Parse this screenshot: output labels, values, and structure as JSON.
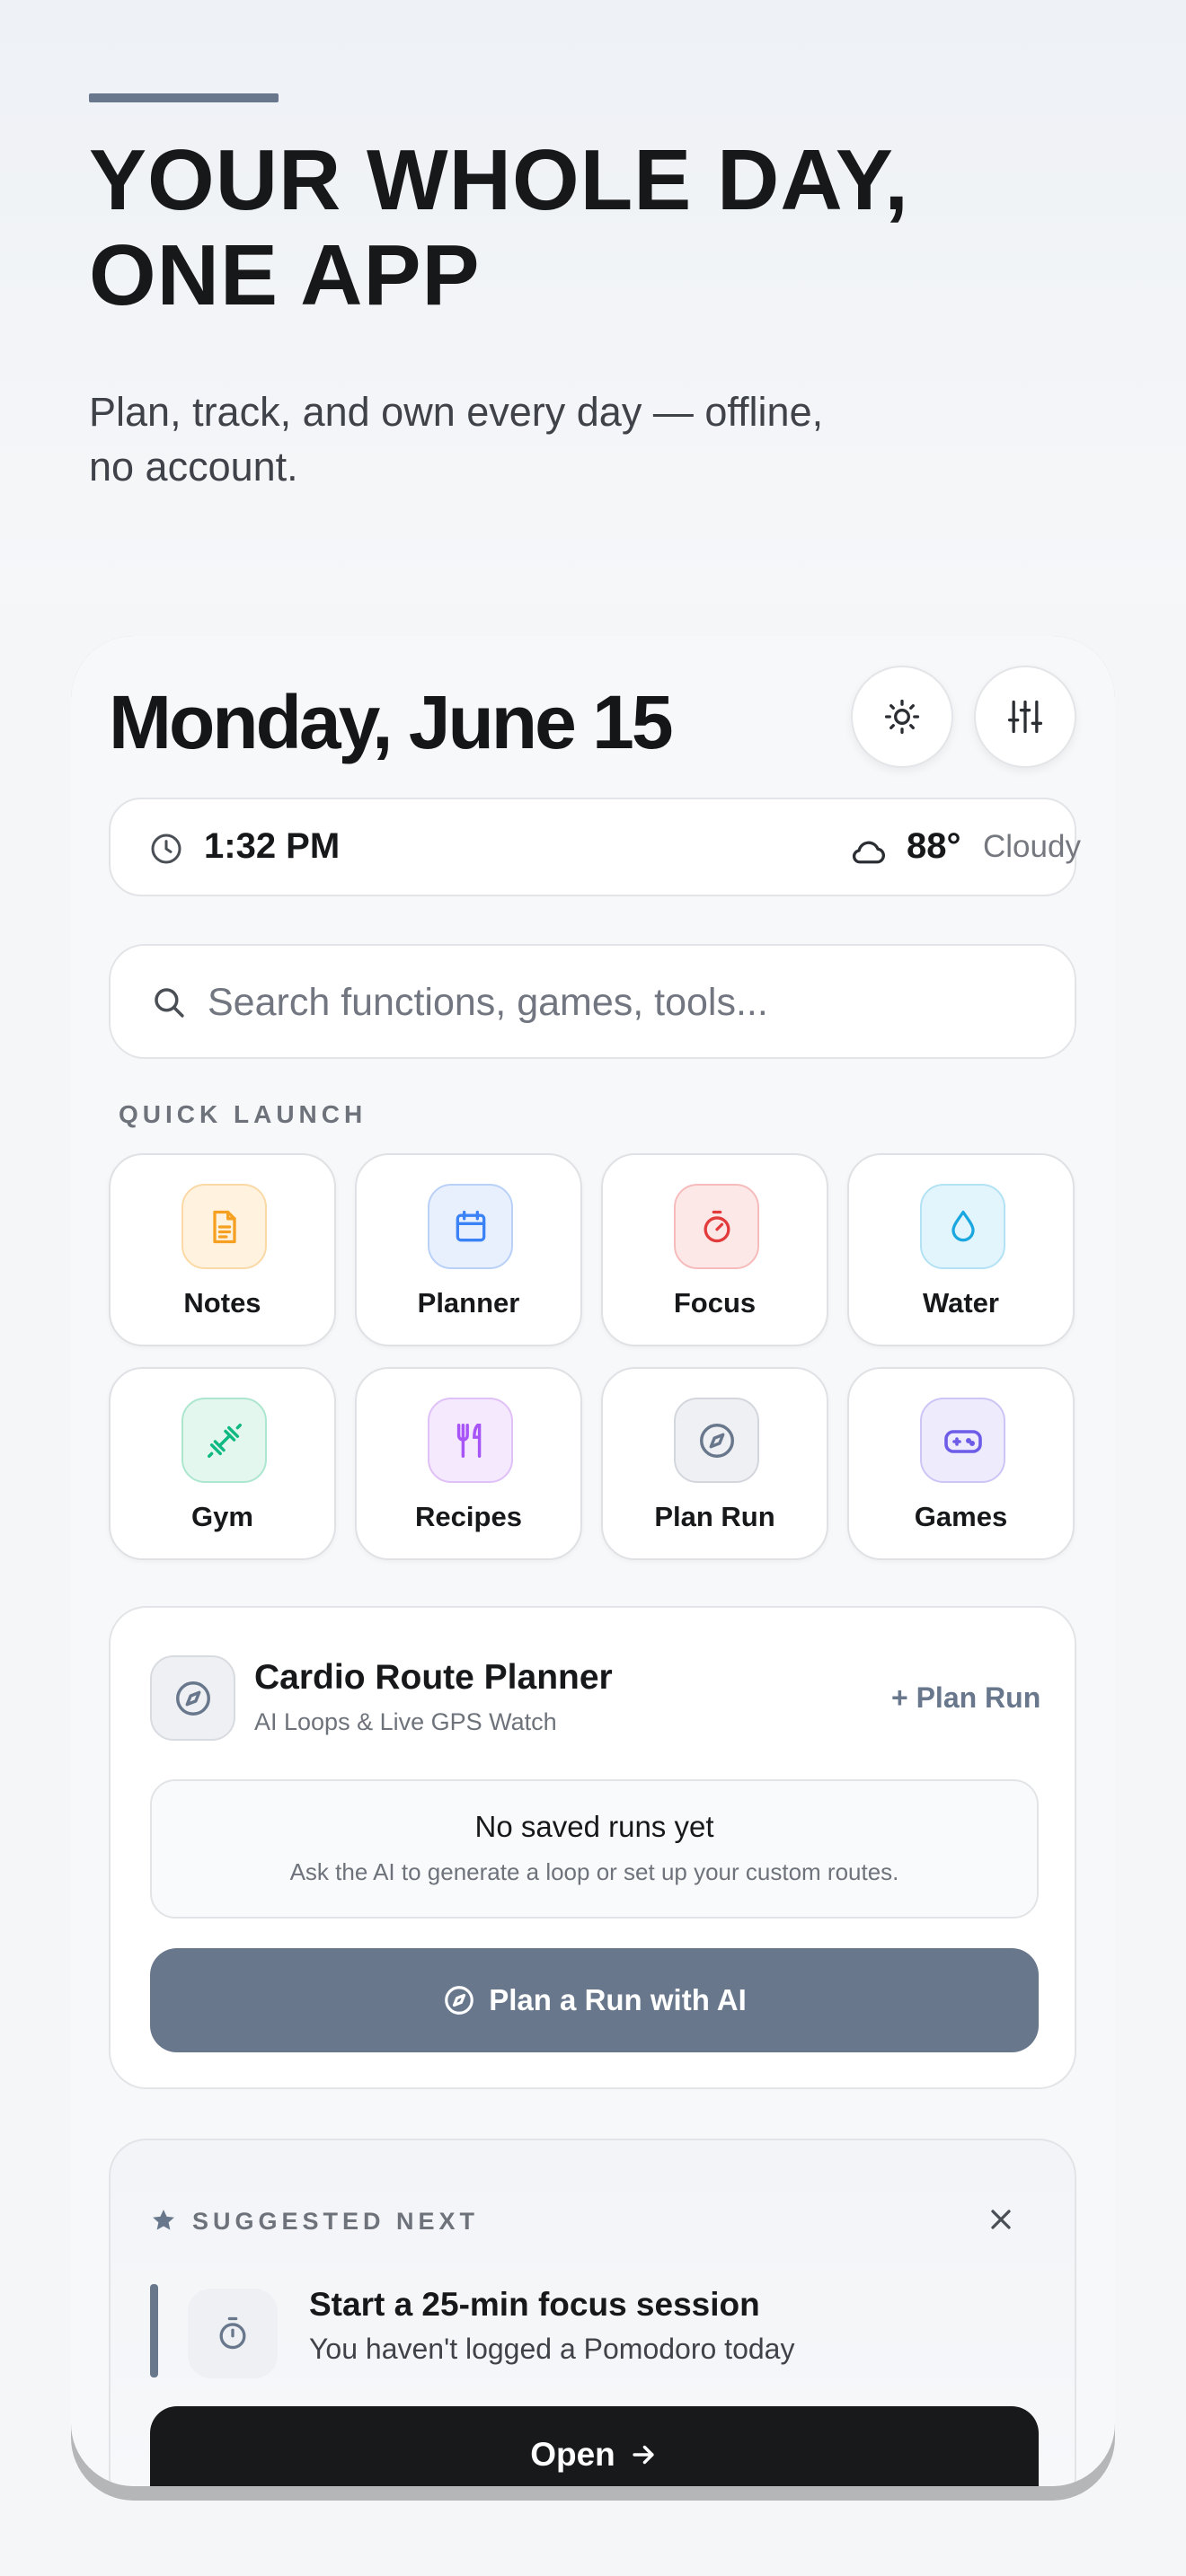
{
  "hero": {
    "title": "YOUR WHOLE DAY,\nONE APP",
    "subtitle": "Plan, track, and own every day — offline,\nno account."
  },
  "header": {
    "date": "Monday, June 15",
    "icons": [
      "sun-icon",
      "sliders-icon"
    ]
  },
  "status": {
    "time": "1:32 PM",
    "temperature": "88°",
    "condition": "Cloudy"
  },
  "search": {
    "placeholder": "Search functions, games, tools..."
  },
  "quick_launch": {
    "label": "QUICK LAUNCH",
    "tiles": [
      {
        "label": "Notes",
        "icon": "document-icon",
        "color": "#f5a020"
      },
      {
        "label": "Planner",
        "icon": "calendar-icon",
        "color": "#3b82f6"
      },
      {
        "label": "Focus",
        "icon": "stopwatch-icon",
        "color": "#e23b3b"
      },
      {
        "label": "Water",
        "icon": "droplet-icon",
        "color": "#1aa7e0"
      },
      {
        "label": "Gym",
        "icon": "dumbbell-icon",
        "color": "#10b981"
      },
      {
        "label": "Recipes",
        "icon": "utensils-icon",
        "color": "#a855f7"
      },
      {
        "label": "Plan Run",
        "icon": "compass-icon",
        "color": "#68778c"
      },
      {
        "label": "Games",
        "icon": "gamepad-icon",
        "color": "#6d5ce7"
      }
    ]
  },
  "cardio": {
    "title": "Cardio Route Planner",
    "subtitle": "AI Loops & Live GPS Watch",
    "add_label": "+ Plan Run",
    "empty_title": "No saved runs yet",
    "empty_subtitle": "Ask the AI to generate a loop or set up your custom routes.",
    "cta_label": "Plan a Run with AI"
  },
  "suggested": {
    "label": "SUGGESTED NEXT",
    "title": "Start a 25-min focus session",
    "subtitle": "You haven't logged a Pomodoro today",
    "cta_label": "Open"
  }
}
